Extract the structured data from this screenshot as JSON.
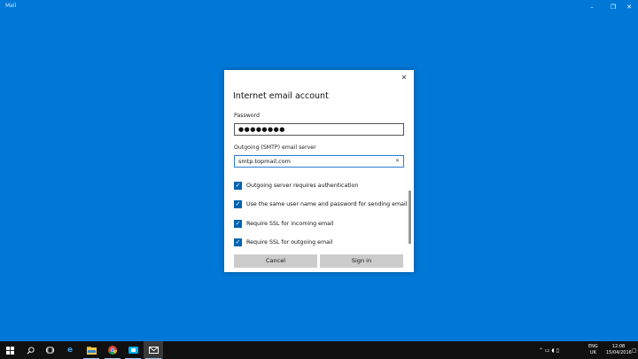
{
  "app": {
    "title": "Mail",
    "controls": {
      "minimize": "–",
      "maximize": "❐",
      "close": "✕"
    }
  },
  "dialog": {
    "title": "Internet email account",
    "close_glyph": "✕",
    "password_label": "Password",
    "password_value": "●●●●●●●●",
    "smtp_label": "Outgoing (SMTP) email server",
    "smtp_value": "smtp.topmail.com",
    "clear_glyph": "✕",
    "checkboxes": [
      {
        "label": "Outgoing server requires authentication",
        "checked": true
      },
      {
        "label": "Use the same user name and password for sending email",
        "checked": true
      },
      {
        "label": "Require SSL for incoming email",
        "checked": true
      },
      {
        "label": "Require SSL for outgoing email",
        "checked": true
      }
    ],
    "check_glyph": "✓",
    "cancel_label": "Cancel",
    "signin_label": "Sign in"
  },
  "taskbar": {
    "icons": [
      "windows-icon",
      "search-icon",
      "task-view-icon",
      "edge-icon",
      "file-explorer-icon",
      "chrome-icon",
      "skype-icon",
      "mail-icon"
    ],
    "edge_glyph": "e",
    "tray_glyphs": "⌃ ▭ ◖ ▯",
    "language": "ENG",
    "region": "UK",
    "time": "12:08",
    "date": "15/04/2016"
  },
  "colors": {
    "desktop": "#0078d7",
    "accent": "#0063b1",
    "taskbar": "#101010"
  }
}
